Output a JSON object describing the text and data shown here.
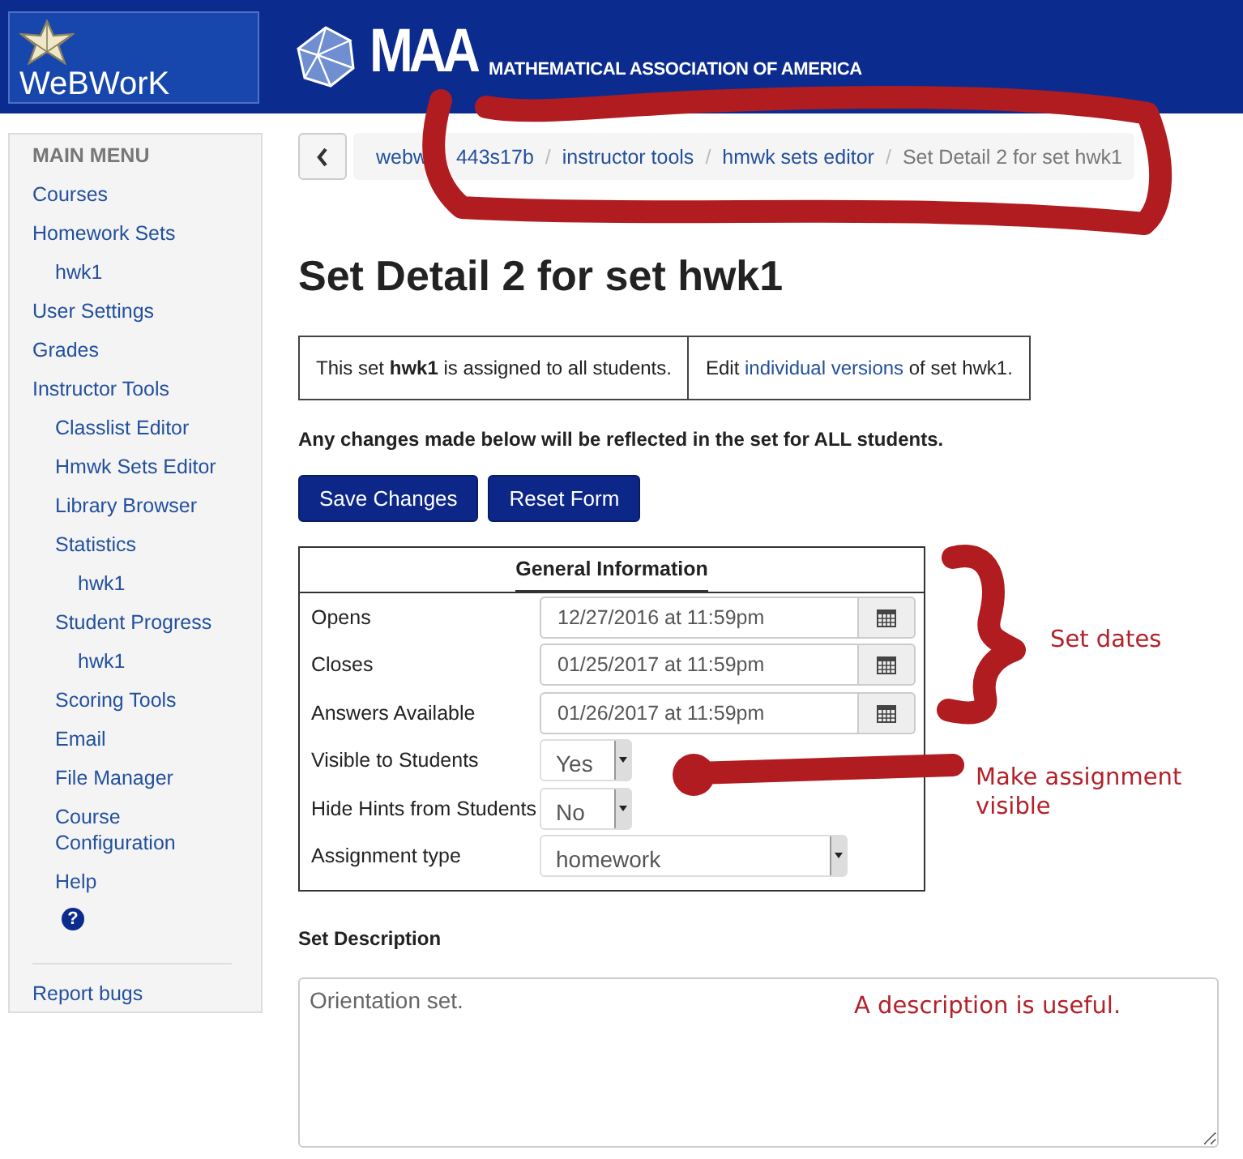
{
  "header": {
    "logo_text": "WeBWorK",
    "org_short": "MAA",
    "org_full": "MATHEMATICAL ASSOCIATION OF AMERICA"
  },
  "sidebar": {
    "heading": "MAIN MENU",
    "items": [
      {
        "label": "Courses"
      },
      {
        "label": "Homework Sets",
        "children": [
          {
            "label": "hwk1"
          }
        ]
      },
      {
        "label": "User Settings"
      },
      {
        "label": "Grades"
      },
      {
        "label": "Instructor Tools",
        "children": [
          {
            "label": "Classlist Editor"
          },
          {
            "label": "Hmwk Sets Editor"
          },
          {
            "label": "Library Browser"
          },
          {
            "label": "Statistics",
            "children": [
              {
                "label": "hwk1"
              }
            ]
          },
          {
            "label": "Student Progress",
            "children": [
              {
                "label": "hwk1"
              }
            ]
          },
          {
            "label": "Scoring Tools"
          },
          {
            "label": "Email"
          },
          {
            "label": "File Manager"
          },
          {
            "label": "Course Configuration"
          },
          {
            "label": "Help"
          }
        ]
      }
    ],
    "help_icon": "?",
    "footer_link": "Report bugs"
  },
  "breadcrumb": {
    "separator": "/",
    "links": [
      "webw",
      "443s17b",
      "instructor tools",
      "hmwk sets editor"
    ],
    "current": "Set Detail 2 for set hwk1"
  },
  "title": "Set Detail 2 for set hwk1",
  "assignment": {
    "status": "This set **hwk1** is assigned to all students.",
    "edit_prefix": "Edit",
    "edit_link": "individual versions",
    "edit_suffix": "of set hwk1."
  },
  "notice": "Any changes made below will be reflected in the set for ALL students.",
  "buttons": [
    "Save Changes",
    "Reset Form"
  ],
  "general_info": {
    "title": "General Information",
    "fields": [
      {
        "label": "Opens",
        "kind": "date",
        "value": "12/27/2016 at 11:59pm"
      },
      {
        "label": "Closes",
        "kind": "date",
        "value": "01/25/2017 at 11:59pm"
      },
      {
        "label": "Answers Available",
        "kind": "date",
        "value": "01/26/2017 at 11:59pm"
      },
      {
        "label": "Visible to Students",
        "kind": "select",
        "value": "Yes"
      },
      {
        "label": "Hide Hints from Students",
        "kind": "select",
        "value": "No"
      },
      {
        "label": "Assignment type",
        "kind": "wide_select",
        "value": "homework"
      }
    ]
  },
  "description": {
    "label": "Set Description",
    "value": "Orientation set."
  },
  "annotations": [
    "Set dates",
    "Make assignment visible",
    "A description is useful."
  ]
}
